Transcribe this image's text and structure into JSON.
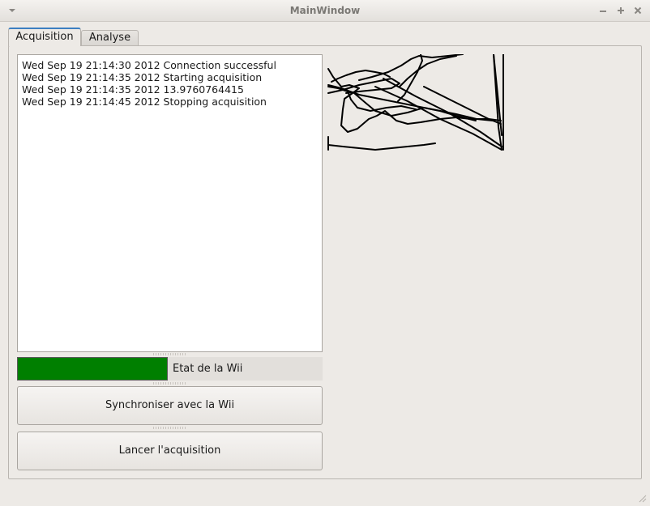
{
  "window": {
    "title": "MainWindow",
    "menu_icon": "chevron-down-icon",
    "controls": [
      "minimize-icon",
      "maximize-icon",
      "close-icon"
    ]
  },
  "tabs": [
    {
      "label": "Acquisition",
      "active": true
    },
    {
      "label": "Analyse",
      "active": false
    }
  ],
  "log": {
    "lines": [
      "Wed Sep 19 21:14:30 2012 Connection successful",
      "Wed Sep 19 21:14:35 2012 Starting acquisition",
      "Wed Sep 19 21:14:35 2012 13.9760764415",
      "Wed Sep 19 21:14:45 2012 Stopping acquisition"
    ]
  },
  "status": {
    "label": "Etat de la Wii",
    "color": "#007f00"
  },
  "buttons": {
    "sync": "Synchroniser avec la Wii",
    "start": "Lancer l'acquisition"
  },
  "colors": {
    "accent": "#3d7fc2",
    "window_bg": "#edeae6",
    "status_ok": "#007f00"
  }
}
